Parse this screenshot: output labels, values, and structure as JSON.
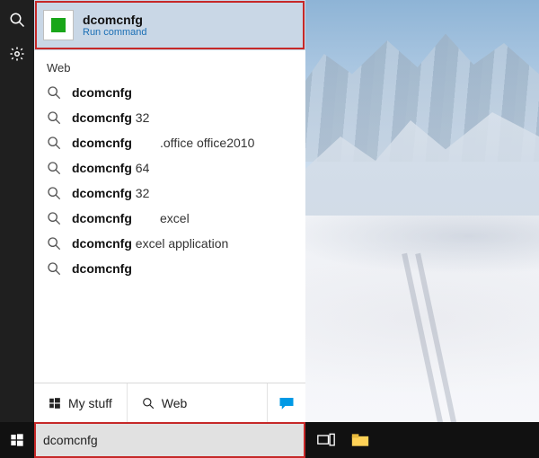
{
  "rail": {
    "search_icon": "search-icon",
    "settings_icon": "gear-icon"
  },
  "best_match": {
    "title": "dcomcnfg",
    "subtitle": "Run command"
  },
  "web": {
    "label": "Web",
    "items": [
      {
        "bold": "dcomcnfg",
        "tail": ""
      },
      {
        "bold": "dcomcnfg",
        "tail": " 32"
      },
      {
        "bold": "dcomcnfg",
        "tail": "        .office office2010"
      },
      {
        "bold": "dcomcnfg",
        "tail": " 64"
      },
      {
        "bold": "dcomcnfg",
        "tail": " 32"
      },
      {
        "bold": "dcomcnfg",
        "tail": "        excel"
      },
      {
        "bold": "dcomcnfg",
        "tail": " excel application"
      },
      {
        "bold": "dcomcnfg",
        "tail": ""
      }
    ]
  },
  "filters": {
    "mystuff": "My stuff",
    "web": "Web"
  },
  "search_box": {
    "value": "dcomcnfg"
  },
  "colors": {
    "highlight": "#c62828",
    "accent_blue": "#1b6fb5",
    "run_green": "#19a619"
  }
}
